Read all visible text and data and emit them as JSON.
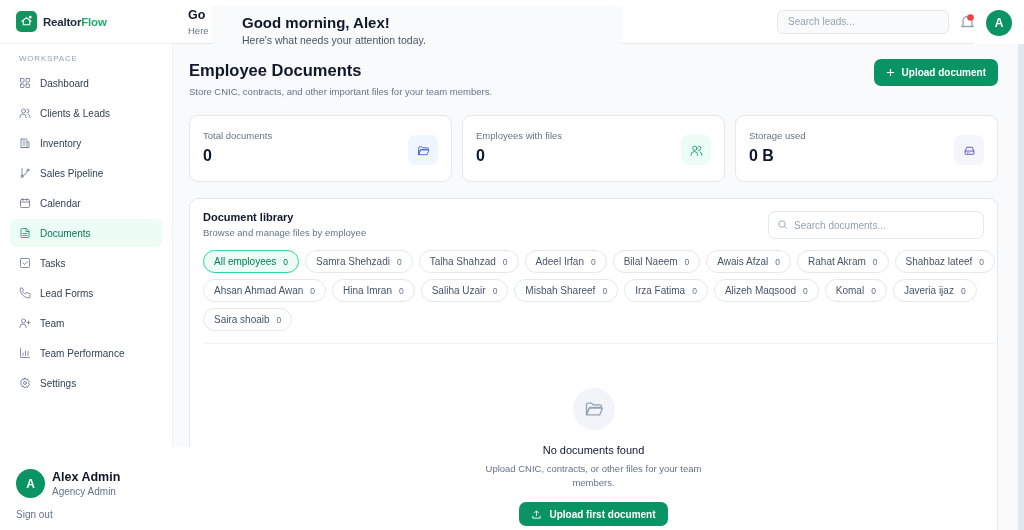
{
  "brand": {
    "name": "Realtor",
    "accent": "Flow"
  },
  "sidebar": {
    "section": "WORKSPACE",
    "items": [
      {
        "label": "Dashboard",
        "selected": false
      },
      {
        "label": "Clients & Leads",
        "selected": false
      },
      {
        "label": "Inventory",
        "selected": false
      },
      {
        "label": "Sales Pipeline",
        "selected": false
      },
      {
        "label": "Calendar",
        "selected": false
      },
      {
        "label": "Documents",
        "selected": true
      },
      {
        "label": "Tasks",
        "selected": false
      },
      {
        "label": "Lead Forms",
        "selected": false
      },
      {
        "label": "Team",
        "selected": false
      },
      {
        "label": "Team Performance",
        "selected": false
      },
      {
        "label": "Settings",
        "selected": false
      }
    ]
  },
  "header": {
    "title": "Go",
    "subtitle": "Here",
    "greeting": {
      "title": "Good morning, Alex!",
      "subtitle": "Here's what needs your attention today."
    },
    "search": {
      "placeholder": "Search leads..."
    },
    "avatar": "A"
  },
  "page": {
    "title": "Employee Documents",
    "subtitle": "Store CNIC, contracts, and other important files for your team members.",
    "upload_button": "Upload document"
  },
  "stats": [
    {
      "label": "Total documents",
      "value": "0"
    },
    {
      "label": "Employees with files",
      "value": "0"
    },
    {
      "label": "Storage used",
      "value": "0 B"
    }
  ],
  "library": {
    "title": "Document library",
    "subtitle": "Browse and manage files by employee",
    "search": {
      "placeholder": "Search documents..."
    },
    "filters": [
      {
        "label": "All employees",
        "count": "0",
        "selected": true
      },
      {
        "label": "Samra Shehzadi",
        "count": "0",
        "selected": false
      },
      {
        "label": "Talha Shahzad",
        "count": "0",
        "selected": false
      },
      {
        "label": "Adeel Irfan",
        "count": "0",
        "selected": false
      },
      {
        "label": "Bilal Naeem",
        "count": "0",
        "selected": false
      },
      {
        "label": "Awais Afzal",
        "count": "0",
        "selected": false
      },
      {
        "label": "Rahat Akram",
        "count": "0",
        "selected": false
      },
      {
        "label": "Shahbaz lateef",
        "count": "0",
        "selected": false
      },
      {
        "label": "Ahsan Ahmad Awan",
        "count": "0",
        "selected": false
      },
      {
        "label": "Hina Imran",
        "count": "0",
        "selected": false
      },
      {
        "label": "Saliha Uzair",
        "count": "0",
        "selected": false
      },
      {
        "label": "Misbah Shareef",
        "count": "0",
        "selected": false
      },
      {
        "label": "Irza Fatima",
        "count": "0",
        "selected": false
      },
      {
        "label": "Alizeh Maqsood",
        "count": "0",
        "selected": false
      },
      {
        "label": "Komal",
        "count": "0",
        "selected": false
      },
      {
        "label": "Javeria ijaz",
        "count": "0",
        "selected": false
      },
      {
        "label": "Saira shoaib",
        "count": "0",
        "selected": false
      }
    ],
    "empty": {
      "title": "No documents found",
      "text": "Upload CNIC, contracts, or other files for your team members.",
      "button": "Upload first document"
    }
  },
  "user": {
    "initial": "A",
    "name": "Alex Admin",
    "role": "Agency Admin",
    "sign_out": "Sign out"
  }
}
